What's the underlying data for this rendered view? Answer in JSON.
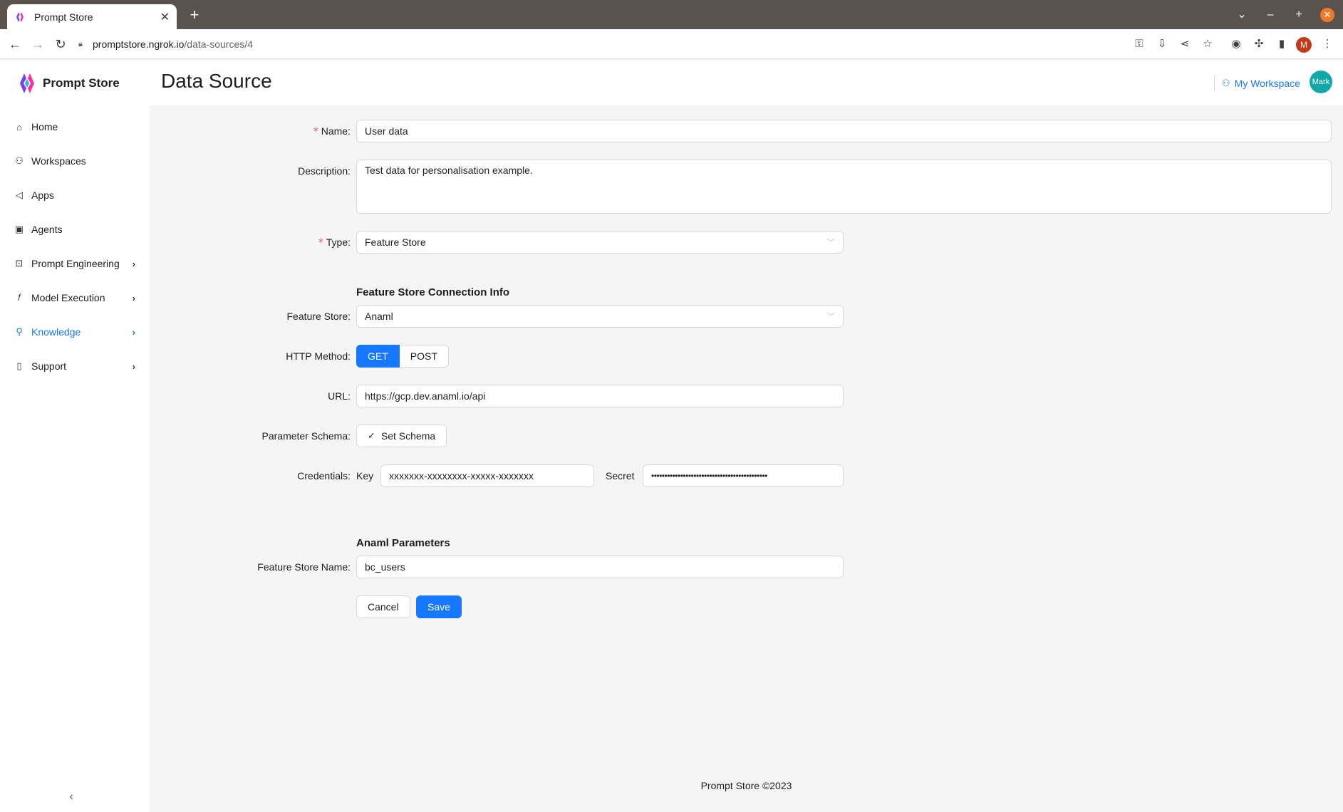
{
  "browser": {
    "tab_title": "Prompt Store",
    "new_tab": "+",
    "url_host": "promptstore.ngrok.io",
    "url_path": "/data-sources/4",
    "profile_initial": "M"
  },
  "app": {
    "brand": "Prompt Store",
    "colors": {
      "primary": "#1677ff",
      "avatar": "#13a8a8",
      "required": "#ff4d4f"
    }
  },
  "sidebar": {
    "items": [
      {
        "label": "Home",
        "icon": "home-icon",
        "has_children": false,
        "active": false
      },
      {
        "label": "Workspaces",
        "icon": "users-icon",
        "has_children": false,
        "active": false
      },
      {
        "label": "Apps",
        "icon": "megaphone-icon",
        "has_children": false,
        "active": false
      },
      {
        "label": "Agents",
        "icon": "robot-icon",
        "has_children": false,
        "active": false
      },
      {
        "label": "Prompt Engineering",
        "icon": "terminal-icon",
        "has_children": true,
        "active": false
      },
      {
        "label": "Model Execution",
        "icon": "function-icon",
        "has_children": true,
        "active": false
      },
      {
        "label": "Knowledge",
        "icon": "network-icon",
        "has_children": true,
        "active": true
      },
      {
        "label": "Support",
        "icon": "book-icon",
        "has_children": true,
        "active": false
      }
    ]
  },
  "header": {
    "title": "Data Source",
    "workspace_link": "My Workspace",
    "avatar_text": "Mark"
  },
  "form": {
    "name": {
      "label": "Name",
      "required": true,
      "value": "User data"
    },
    "description": {
      "label": "Description",
      "value": "Test data for personalisation example."
    },
    "type": {
      "label": "Type",
      "required": true,
      "value": "Feature Store"
    },
    "connection_section": "Feature Store Connection Info",
    "feature_store": {
      "label": "Feature Store",
      "value": "Anaml"
    },
    "http_method": {
      "label": "HTTP Method",
      "options": [
        "GET",
        "POST"
      ],
      "selected": "GET"
    },
    "url": {
      "label": "URL",
      "value": "https://gcp.dev.anaml.io/api"
    },
    "parameter_schema": {
      "label": "Parameter Schema",
      "button": "Set Schema"
    },
    "credentials": {
      "label": "Credentials",
      "key_label": "Key",
      "key_value": "xxxxxxx-xxxxxxxx-xxxxx-xxxxxxx",
      "secret_label": "Secret",
      "secret_value": "••••••••••••••••••••••••••••••••••••••••••••"
    },
    "params_section": "Anaml Parameters",
    "feature_store_name": {
      "label": "Feature Store Name",
      "value": "bc_users"
    },
    "cancel": "Cancel",
    "save": "Save"
  },
  "footer": {
    "text": "Prompt Store ©2023"
  }
}
